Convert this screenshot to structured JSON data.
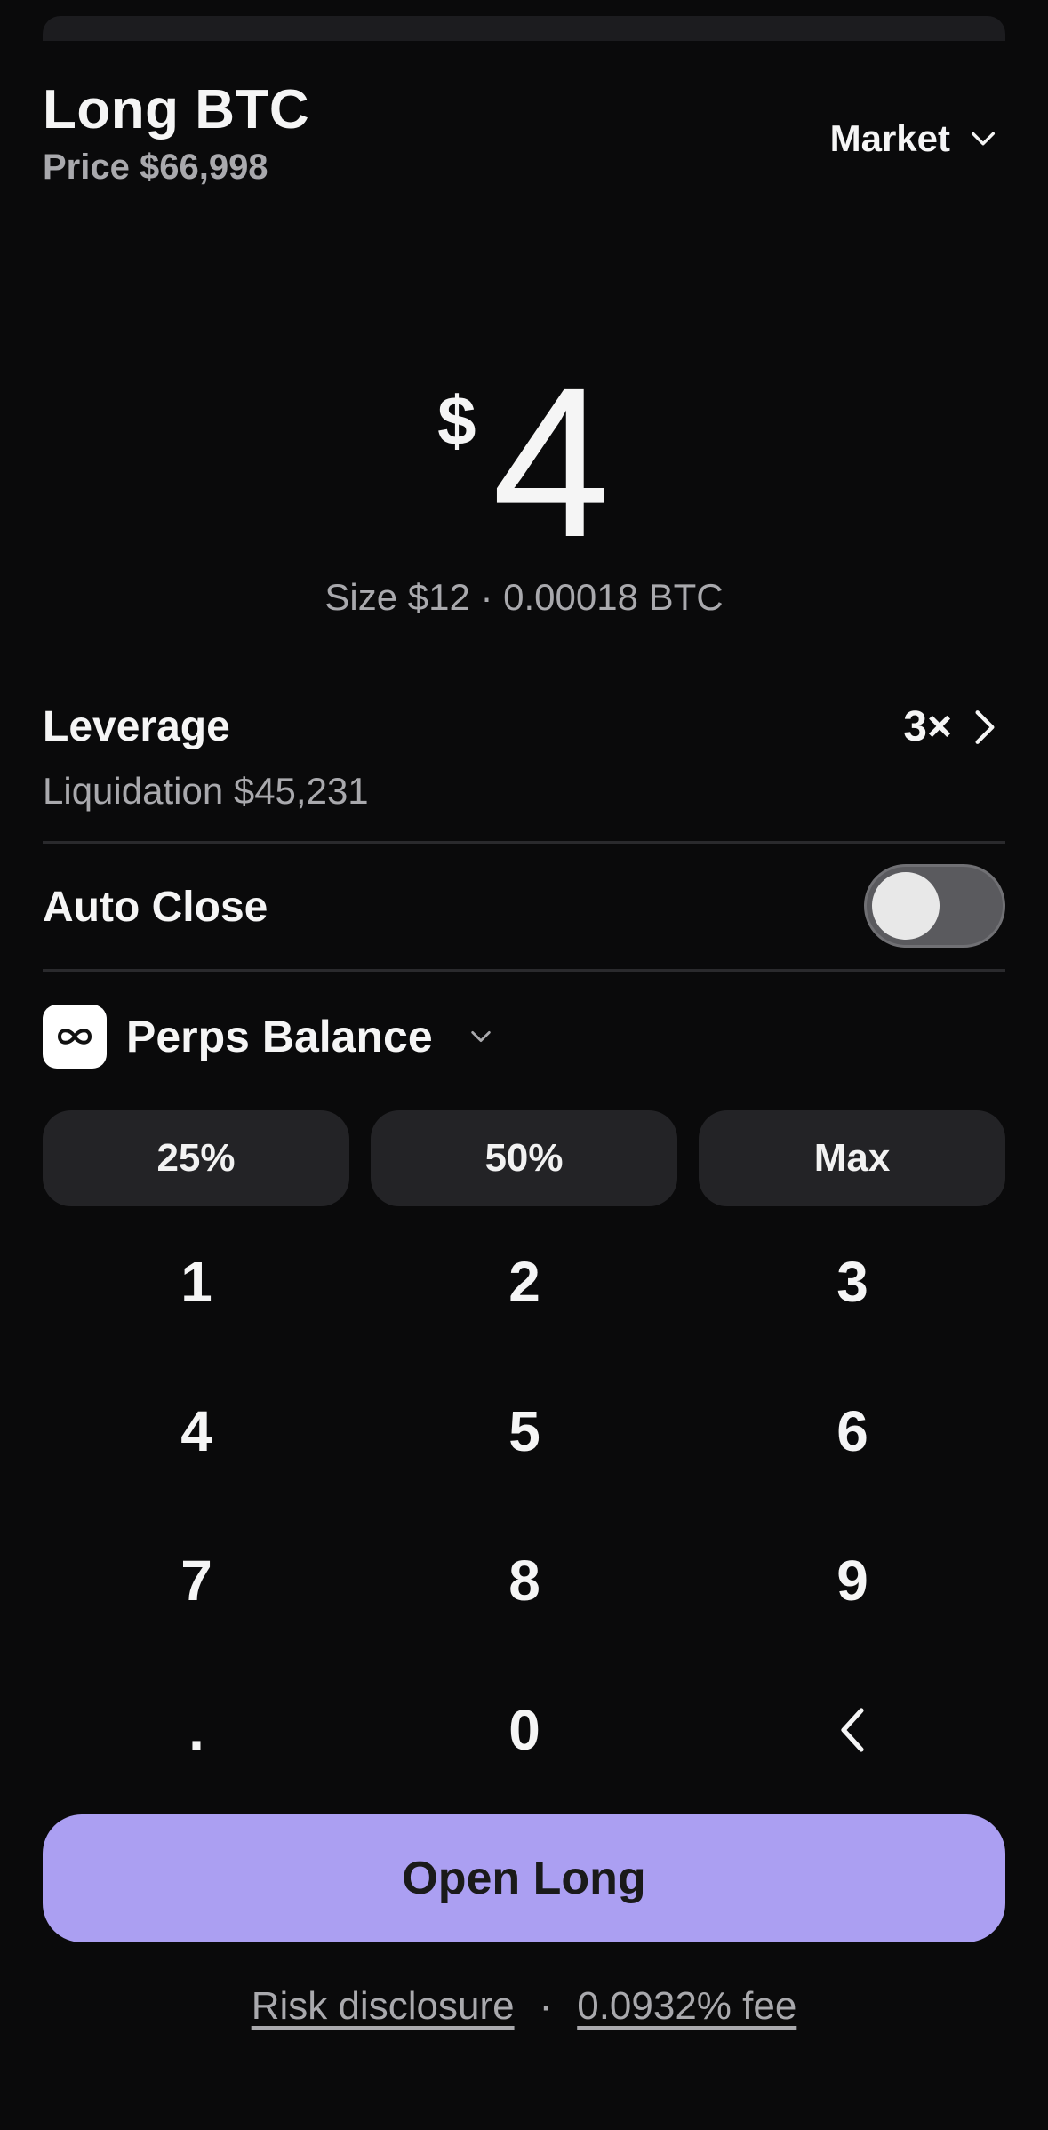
{
  "header": {
    "title": "Long BTC",
    "price_line": "Price $66,998",
    "order_type": "Market",
    "order_type_icon": "chevron-down-icon"
  },
  "amount": {
    "currency": "$",
    "value": "4",
    "size_line": "Size $12 · 0.00018 BTC"
  },
  "leverage": {
    "label": "Leverage",
    "value": "3×",
    "liquidation": "Liquidation $45,231"
  },
  "auto_close": {
    "label": "Auto Close",
    "enabled": false
  },
  "balance": {
    "icon": "infinity-icon",
    "label": "Perps Balance"
  },
  "percent_buttons": [
    "25%",
    "50%",
    "Max"
  ],
  "keypad": {
    "keys": [
      "1",
      "2",
      "3",
      "4",
      "5",
      "6",
      "7",
      "8",
      "9",
      ".",
      "0"
    ],
    "backspace_icon": "backspace-chevron-icon"
  },
  "cta": {
    "label": "Open Long"
  },
  "footer": {
    "risk": "Risk disclosure",
    "separator": "·",
    "fee": "0.0932% fee"
  },
  "colors": {
    "background": "#0a0a0b",
    "accent": "#ab9ff2",
    "muted_text": "#a9a9ad",
    "button_bg": "#232326"
  }
}
